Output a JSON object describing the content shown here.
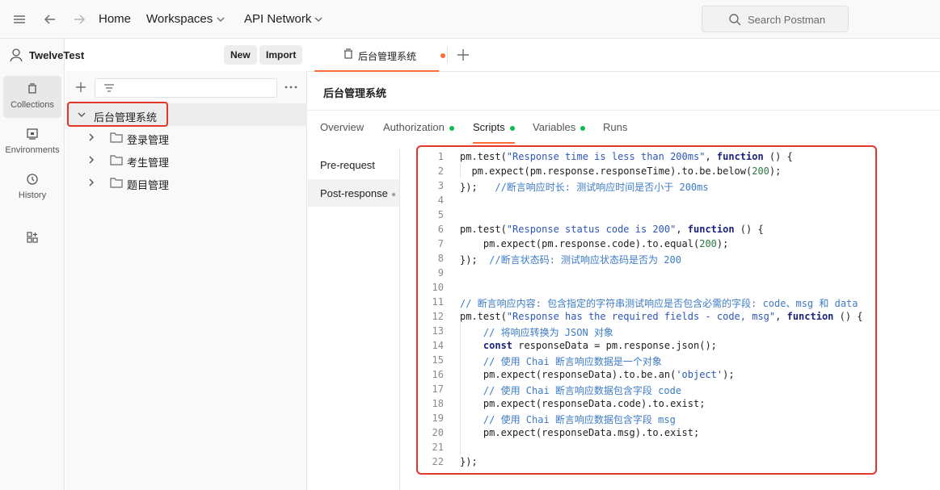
{
  "topbar": {
    "home": "Home",
    "workspaces": "Workspaces",
    "api_network": "API Network",
    "search_placeholder": "Search Postman"
  },
  "rail": {
    "items": [
      {
        "label": "Collections",
        "icon": "collections-icon",
        "active": true
      },
      {
        "label": "Environments",
        "icon": "environments-icon",
        "active": false
      },
      {
        "label": "History",
        "icon": "history-icon",
        "active": false
      },
      {
        "label": "",
        "icon": "apps-icon",
        "active": false
      }
    ]
  },
  "workspace": {
    "name": "TwelveTest",
    "new_label": "New",
    "import_label": "Import"
  },
  "tree": {
    "collection": "后台管理系统",
    "folders": [
      "登录管理",
      "考生管理",
      "题目管理"
    ]
  },
  "tab": {
    "label": "后台管理系统"
  },
  "collection_title": "后台管理系统",
  "subtabs": [
    {
      "label": "Overview",
      "dot": false,
      "active": false
    },
    {
      "label": "Authorization",
      "dot": true,
      "active": false
    },
    {
      "label": "Scripts",
      "dot": true,
      "active": true
    },
    {
      "label": "Variables",
      "dot": true,
      "active": false
    },
    {
      "label": "Runs",
      "dot": false,
      "active": false
    }
  ],
  "script_nav": {
    "pre_request": "Pre-request",
    "post_response": "Post-response"
  },
  "code_lines": [
    "1",
    "2",
    "3",
    "4",
    "5",
    "6",
    "7",
    "8",
    "9",
    "10",
    "11",
    "12",
    "13",
    "14",
    "15",
    "16",
    "17",
    "18",
    "19",
    "20",
    "21",
    "22"
  ],
  "code": [
    [
      [
        "pm.test(",
        ""
      ],
      [
        "\"Response time is less than 200ms\"",
        "str"
      ],
      [
        ", ",
        ""
      ],
      [
        "function",
        "kw"
      ],
      [
        " () {",
        ""
      ]
    ],
    [
      [
        "  pm.expect(pm.response.responseTime).to.be.below(",
        ""
      ],
      [
        "200",
        "num"
      ],
      [
        ");",
        ""
      ]
    ],
    [
      [
        "});   ",
        ""
      ],
      [
        "//断言响应时长: 测试响应时间是否小于 200ms",
        "cmt"
      ]
    ],
    [],
    [],
    [
      [
        "pm.test(",
        ""
      ],
      [
        "\"Response status code is 200\"",
        "str"
      ],
      [
        ", ",
        ""
      ],
      [
        "function",
        "kw"
      ],
      [
        " () {",
        ""
      ]
    ],
    [
      [
        "    pm.expect(pm.response.code).to.equal(",
        ""
      ],
      [
        "200",
        "num"
      ],
      [
        ");",
        ""
      ]
    ],
    [
      [
        "});  ",
        ""
      ],
      [
        "//断言状态码: 测试响应状态码是否为 200",
        "cmt"
      ]
    ],
    [],
    [],
    [
      [
        "// 断言响应内容: 包含指定的字符串测试响应是否包含必需的字段: code、msg 和 data",
        "cmt"
      ]
    ],
    [
      [
        "pm.test(",
        ""
      ],
      [
        "\"Response has the required fields - code, msg\"",
        "str"
      ],
      [
        ", ",
        ""
      ],
      [
        "function",
        "kw"
      ],
      [
        " () {",
        ""
      ]
    ],
    [
      [
        "    ",
        ""
      ],
      [
        "// 将响应转换为 JSON 对象",
        "cmt"
      ]
    ],
    [
      [
        "    ",
        ""
      ],
      [
        "const",
        "kw"
      ],
      [
        " responseData = pm.response.json();",
        ""
      ]
    ],
    [
      [
        "    ",
        ""
      ],
      [
        "// 使用 Chai 断言响应数据是一个对象",
        "cmt"
      ]
    ],
    [
      [
        "    pm.expect(responseData).to.be.an(",
        ""
      ],
      [
        "'object'",
        "str"
      ],
      [
        ");",
        ""
      ]
    ],
    [
      [
        "    ",
        ""
      ],
      [
        "// 使用 Chai 断言响应数据包含字段 code",
        "cmt"
      ]
    ],
    [
      [
        "    pm.expect(responseData.code).to.exist;",
        ""
      ]
    ],
    [
      [
        "    ",
        ""
      ],
      [
        "// 使用 Chai 断言响应数据包含字段 msg",
        "cmt"
      ]
    ],
    [
      [
        "    pm.expect(responseData.msg).to.exist;",
        ""
      ]
    ],
    [],
    [
      [
        "});",
        ""
      ]
    ]
  ],
  "colors": {
    "accent": "#ff6c37",
    "status_green": "#0cbb52",
    "highlight_red": "#e0362c"
  }
}
